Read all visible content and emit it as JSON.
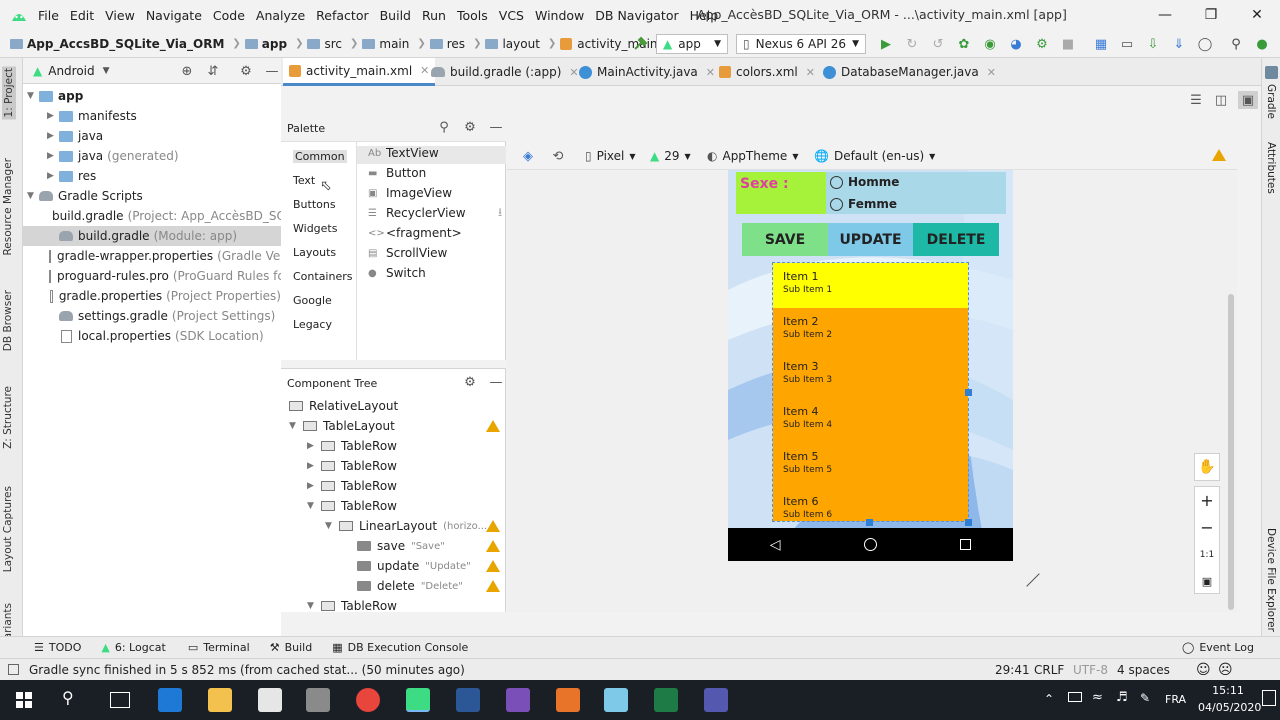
{
  "window": {
    "menu": [
      "File",
      "Edit",
      "View",
      "Navigate",
      "Code",
      "Analyze",
      "Refactor",
      "Build",
      "Run",
      "Tools",
      "VCS",
      "Window",
      "DB Navigator",
      "Help"
    ],
    "title": "App_AccèsBD_SQLite_Via_ORM - ...\\activity_main.xml [app]"
  },
  "nav": {
    "crumbs": [
      "App_AccsBD_SQLite_Via_ORM",
      "app",
      "src",
      "main",
      "res",
      "layout",
      "activity_main.xml"
    ],
    "run_config": "app",
    "device": "Nexus 6 API 26"
  },
  "left_strip": [
    "1: Project",
    "Resource Manager",
    "DB Browser",
    "Z: Structure",
    "Layout Captures",
    "Variants"
  ],
  "right_strip": [
    "Gradle",
    "Attributes",
    "Device File Explorer"
  ],
  "project": {
    "view": "Android",
    "tree": [
      {
        "label": "app",
        "sub": "",
        "bold": true,
        "level": 0,
        "arrow": "down",
        "icon": "folder"
      },
      {
        "label": "manifests",
        "sub": "",
        "level": 1,
        "arrow": "right",
        "icon": "folder"
      },
      {
        "label": "java",
        "sub": "",
        "level": 1,
        "arrow": "right",
        "icon": "folder"
      },
      {
        "label": "java",
        "sub": "(generated)",
        "level": 1,
        "arrow": "right",
        "icon": "folder"
      },
      {
        "label": "res",
        "sub": "",
        "level": 1,
        "arrow": "right",
        "icon": "folder"
      },
      {
        "label": "Gradle Scripts",
        "sub": "",
        "level": 0,
        "arrow": "down",
        "icon": "gradle"
      },
      {
        "label": "build.gradle",
        "sub": "(Project: App_AccèsBD_SQ",
        "level": 1,
        "arrow": "",
        "icon": "gradle"
      },
      {
        "label": "build.gradle",
        "sub": "(Module: app)",
        "level": 1,
        "arrow": "",
        "icon": "gradle",
        "selected": true
      },
      {
        "label": "gradle-wrapper.properties",
        "sub": "(Gradle Ver",
        "level": 1,
        "arrow": "",
        "icon": "file"
      },
      {
        "label": "proguard-rules.pro",
        "sub": "(ProGuard Rules fc",
        "level": 1,
        "arrow": "",
        "icon": "file"
      },
      {
        "label": "gradle.properties",
        "sub": "(Project Properties)",
        "level": 1,
        "arrow": "",
        "icon": "file"
      },
      {
        "label": "settings.gradle",
        "sub": "(Project Settings)",
        "level": 1,
        "arrow": "",
        "icon": "gradle"
      },
      {
        "label": "local.properties",
        "sub": "(SDK Location)",
        "level": 1,
        "arrow": "",
        "icon": "file"
      }
    ]
  },
  "editor_tabs": [
    {
      "label": "activity_main.xml",
      "active": true,
      "icon": "xml"
    },
    {
      "label": "build.gradle (:app)",
      "active": false,
      "icon": "gradle"
    },
    {
      "label": "MainActivity.java",
      "active": false,
      "icon": "class"
    },
    {
      "label": "colors.xml",
      "active": false,
      "icon": "xml"
    },
    {
      "label": "DatabaseManager.java",
      "active": false,
      "icon": "class"
    }
  ],
  "palette": {
    "title": "Palette",
    "categories": [
      "Common",
      "Text",
      "Buttons",
      "Widgets",
      "Layouts",
      "Containers",
      "Google",
      "Legacy"
    ],
    "items": [
      "TextView",
      "Button",
      "ImageView",
      "RecyclerView",
      "<fragment>",
      "ScrollView",
      "Switch"
    ],
    "textview_prefix": "Ab"
  },
  "design_toolbar": {
    "device": "Pixel",
    "api": "29",
    "theme": "AppTheme",
    "locale": "Default (en-us)"
  },
  "component_tree": {
    "title": "Component Tree",
    "nodes": [
      {
        "label": "RelativeLayout",
        "hint": "",
        "level": 0,
        "arrow": "",
        "warn": false,
        "icon": "layout"
      },
      {
        "label": "TableLayout",
        "hint": "",
        "level": 0,
        "arrow": "down",
        "warn": true,
        "icon": "layout"
      },
      {
        "label": "TableRow",
        "hint": "",
        "level": 1,
        "arrow": "right",
        "warn": false,
        "icon": "layout"
      },
      {
        "label": "TableRow",
        "hint": "",
        "level": 1,
        "arrow": "right",
        "warn": false,
        "icon": "layout"
      },
      {
        "label": "TableRow",
        "hint": "",
        "level": 1,
        "arrow": "right",
        "warn": false,
        "icon": "layout"
      },
      {
        "label": "TableRow",
        "hint": "",
        "level": 1,
        "arrow": "down",
        "warn": false,
        "icon": "layout"
      },
      {
        "label": "LinearLayout",
        "hint": "(horizo...",
        "level": 2,
        "arrow": "down",
        "warn": true,
        "icon": "linear"
      },
      {
        "label": "save",
        "hint": "\"Save\"",
        "level": 3,
        "arrow": "",
        "warn": true,
        "icon": "button"
      },
      {
        "label": "update",
        "hint": "\"Update\"",
        "level": 3,
        "arrow": "",
        "warn": true,
        "icon": "button"
      },
      {
        "label": "delete",
        "hint": "\"Delete\"",
        "level": 3,
        "arrow": "",
        "warn": true,
        "icon": "button"
      },
      {
        "label": "TableRow",
        "hint": "",
        "level": 1,
        "arrow": "down",
        "warn": false,
        "icon": "layout"
      }
    ]
  },
  "phone": {
    "sexe_label": "Sexe :",
    "radio_homme": "Homme",
    "radio_femme": "Femme",
    "btn_save": "SAVE",
    "btn_update": "UPDATE",
    "btn_delete": "DELETE",
    "list": [
      {
        "title": "Item 1",
        "sub": "Sub Item 1"
      },
      {
        "title": "Item 2",
        "sub": "Sub Item 2"
      },
      {
        "title": "Item 3",
        "sub": "Sub Item 3"
      },
      {
        "title": "Item 4",
        "sub": "Sub Item 4"
      },
      {
        "title": "Item 5",
        "sub": "Sub Item 5"
      },
      {
        "title": "Item 6",
        "sub": "Sub Item 6"
      }
    ],
    "colors": {
      "sexe_bg": "#a6f23a",
      "sexe_text": "#e040a0",
      "radio_bg": "#a9d8e9",
      "save_bg": "#7fe08a",
      "update_bg": "#7ec8e8",
      "delete_bg": "#1eb8a6",
      "item_first": "#ffff00",
      "item_bg": "#ffa500"
    }
  },
  "zoom_controls": [
    "+",
    "−",
    "1:1"
  ],
  "bottom_tabs": [
    "TODO",
    "6: Logcat",
    "Terminal",
    "Build",
    "DB Execution Console"
  ],
  "event_log": "Event Log",
  "status": {
    "message": "Gradle sync finished in 5 s 852 ms (from cached stat... (50 minutes ago)",
    "position": "29:41",
    "line_sep": "CRLF",
    "encoding": "UTF-8",
    "indent": "4 spaces"
  },
  "taskbar": {
    "lang": "FRA",
    "time": "15:11",
    "date": "04/05/2020"
  }
}
